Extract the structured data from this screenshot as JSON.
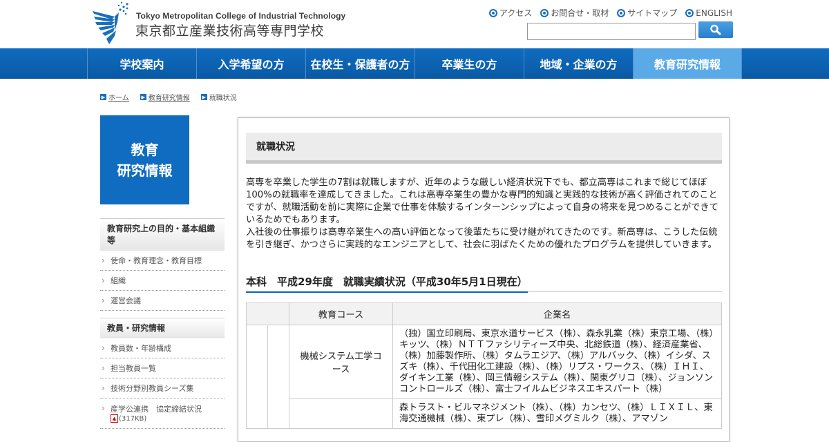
{
  "header": {
    "logo_en": "Tokyo Metropolitan College of Industrial Technology",
    "logo_ja": "東京都立産業技術高等専門学校",
    "util_links": [
      "アクセス",
      "お問合せ・取材",
      "サイトマップ",
      "ENGLISH"
    ],
    "search": {
      "value": "",
      "button_icon": "search-icon"
    }
  },
  "nav": {
    "items": [
      "学校案内",
      "入学希望の方",
      "在校生・保護者の方",
      "卒業生の方",
      "地域・企業の方",
      "教育研究情報"
    ],
    "active_index": 5
  },
  "breadcrumb": [
    "ホーム",
    "教育研究情報",
    "就職状況"
  ],
  "sidebar": {
    "title_line1": "教育",
    "title_line2": "研究情報",
    "groups": [
      {
        "heading": "教育研究上の目的・基本組織等",
        "links": [
          "使命・教育理念・教育目標",
          "組織",
          "運営会議"
        ]
      },
      {
        "heading": "教員・研究情報",
        "links": [
          "教員数・年齢構成",
          "担当教員一覧",
          "技術分野別教員シーズ集"
        ]
      }
    ],
    "pdf_link": {
      "label": "産学公連携　協定締結状況",
      "size": "(317KB)"
    }
  },
  "main": {
    "title": "就職状況",
    "intro_p1": "高専を卒業した学生の7割は就職しますが、近年のような厳しい経済状況下でも、都立高専はこれまで総じてほぼ100%の就職率を達成してきました。これは高専卒業生の豊かな専門的知識と実践的な技術が高く評価されてのことですが、就職活動を前に実際に企業で仕事を体験するインターンシップによって自身の将来を見つめることができているためでもあります。",
    "intro_p2": "入社後の仕事振りは高専卒業生への高い評価となって後輩たちに受け継がれてきたのです。新高専は、こうした伝統を引き継ぎ、かつさらに実践的なエンジニアとして、社会に羽ばたくための優れたプログラムを提供していきます。",
    "section_heading": "本科　平成29年度　就職実績状況（平成30年5月1日現在）",
    "table": {
      "headers": [
        "教育コース",
        "企業名"
      ],
      "rows": [
        {
          "course": "機械システム工学コース",
          "companies": "（独）国立印刷局、東京水道サービス（株）、森永乳業（株）東京工場、（株）キッツ、（株）ＮＴＴファシリティーズ中央、北総鉄道（株）、経済産業省、（株）加藤製作所、（株）タムラエジア、（株）アルバック、（株）イシダ、スズキ（株）、千代田化工建設（株）、（株）リプス・ワークス、（株）ＩＨＩ、ダイキン工業（株）、岡三情報システム（株）、関東グリコ（株）、ジョンソンコントロールズ（株）、富士フイルムビジネスエキスパート（株）"
        },
        {
          "course": "",
          "companies": "森トラスト・ビルマネジメント（株）、（株）カンセツ、（株）ＬＩＸＩＬ、東海交通機械（株）、東プレ（株）、雪印メグミルク（株）、アマゾン"
        }
      ]
    }
  },
  "colors": {
    "nav_blue": "#0f6cc0",
    "nav_active": "#5aaae8",
    "accent": "#1a6fba"
  }
}
